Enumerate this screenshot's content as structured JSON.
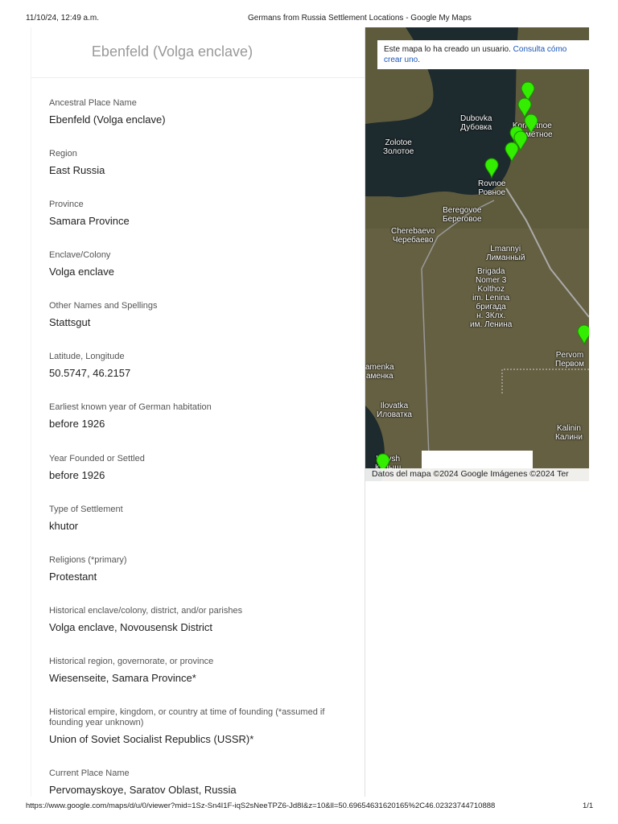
{
  "header": {
    "datetime": "11/10/24, 12:49 a.m.",
    "title": "Germans from Russia Settlement Locations - Google My Maps"
  },
  "panel": {
    "title": "Ebenfeld (Volga enclave)",
    "fields": [
      {
        "label": "Ancestral Place Name",
        "value": "Ebenfeld (Volga enclave)"
      },
      {
        "label": "Region",
        "value": "East Russia"
      },
      {
        "label": "Province",
        "value": "Samara Province"
      },
      {
        "label": "Enclave/Colony",
        "value": "Volga enclave"
      },
      {
        "label": "Other Names and Spellings",
        "value": "Stattsgut"
      },
      {
        "label": "Latitude, Longitude",
        "value": "50.5747, 46.2157"
      },
      {
        "label": "Earliest known year of German habitation",
        "value": "before 1926"
      },
      {
        "label": "Year Founded or Settled",
        "value": "before 1926"
      },
      {
        "label": "Type of Settlement",
        "value": "khutor"
      },
      {
        "label": "Religions (*primary)",
        "value": "Protestant"
      },
      {
        "label": "Historical enclave/colony, district, and/or parishes",
        "value": "Volga enclave, Novousensk District"
      },
      {
        "label": "Historical region, governorate, or province",
        "value": "Wiesenseite, Samara Province*"
      },
      {
        "label": "Historical empire, kingdom, or country at time of founding (*assumed if founding year unknown)",
        "value": "Union of Soviet Socialist Republics (USSR)*"
      },
      {
        "label": "Current Place Name",
        "value": "Pervomayskoye, Saratov Oblast, Russia"
      }
    ]
  },
  "map": {
    "notice": "Este mapa lo ha creado un usuario.",
    "notice_link": "Consulta cómo crear uno",
    "attribution": "Datos del mapa ©2024 Google Imágenes ©2024 Ter",
    "labels": [
      "Dubovka\nДубовка",
      "Zolotoe\nЗолотое",
      "Kormetnoe\nКормётное",
      "Rovnoe\nРовное",
      "Beregovoe\nБереговое",
      "Cherebaevo\nЧеребаево",
      "Lmannyi\nЛиманный",
      "Brigada\nNomer 3\nKolthoz\nim. Lenina\nбригада\nн. 3Клх.\nим. Ленина",
      "Pervom\nПервом",
      "amenka\nаменка",
      "Ilovatka\nИловатка",
      "Kalinin\nКалини",
      "Kolysh\nКолыш"
    ],
    "pin_color": "#33ee00"
  },
  "footer": {
    "url": "https://www.google.com/maps/d/u/0/viewer?mid=1Sz-Sn4I1F-iqS2sNeeTPZ6-Jd8I&z=10&ll=50.69654631620165%2C46.02323744710888",
    "page": "1/1"
  }
}
